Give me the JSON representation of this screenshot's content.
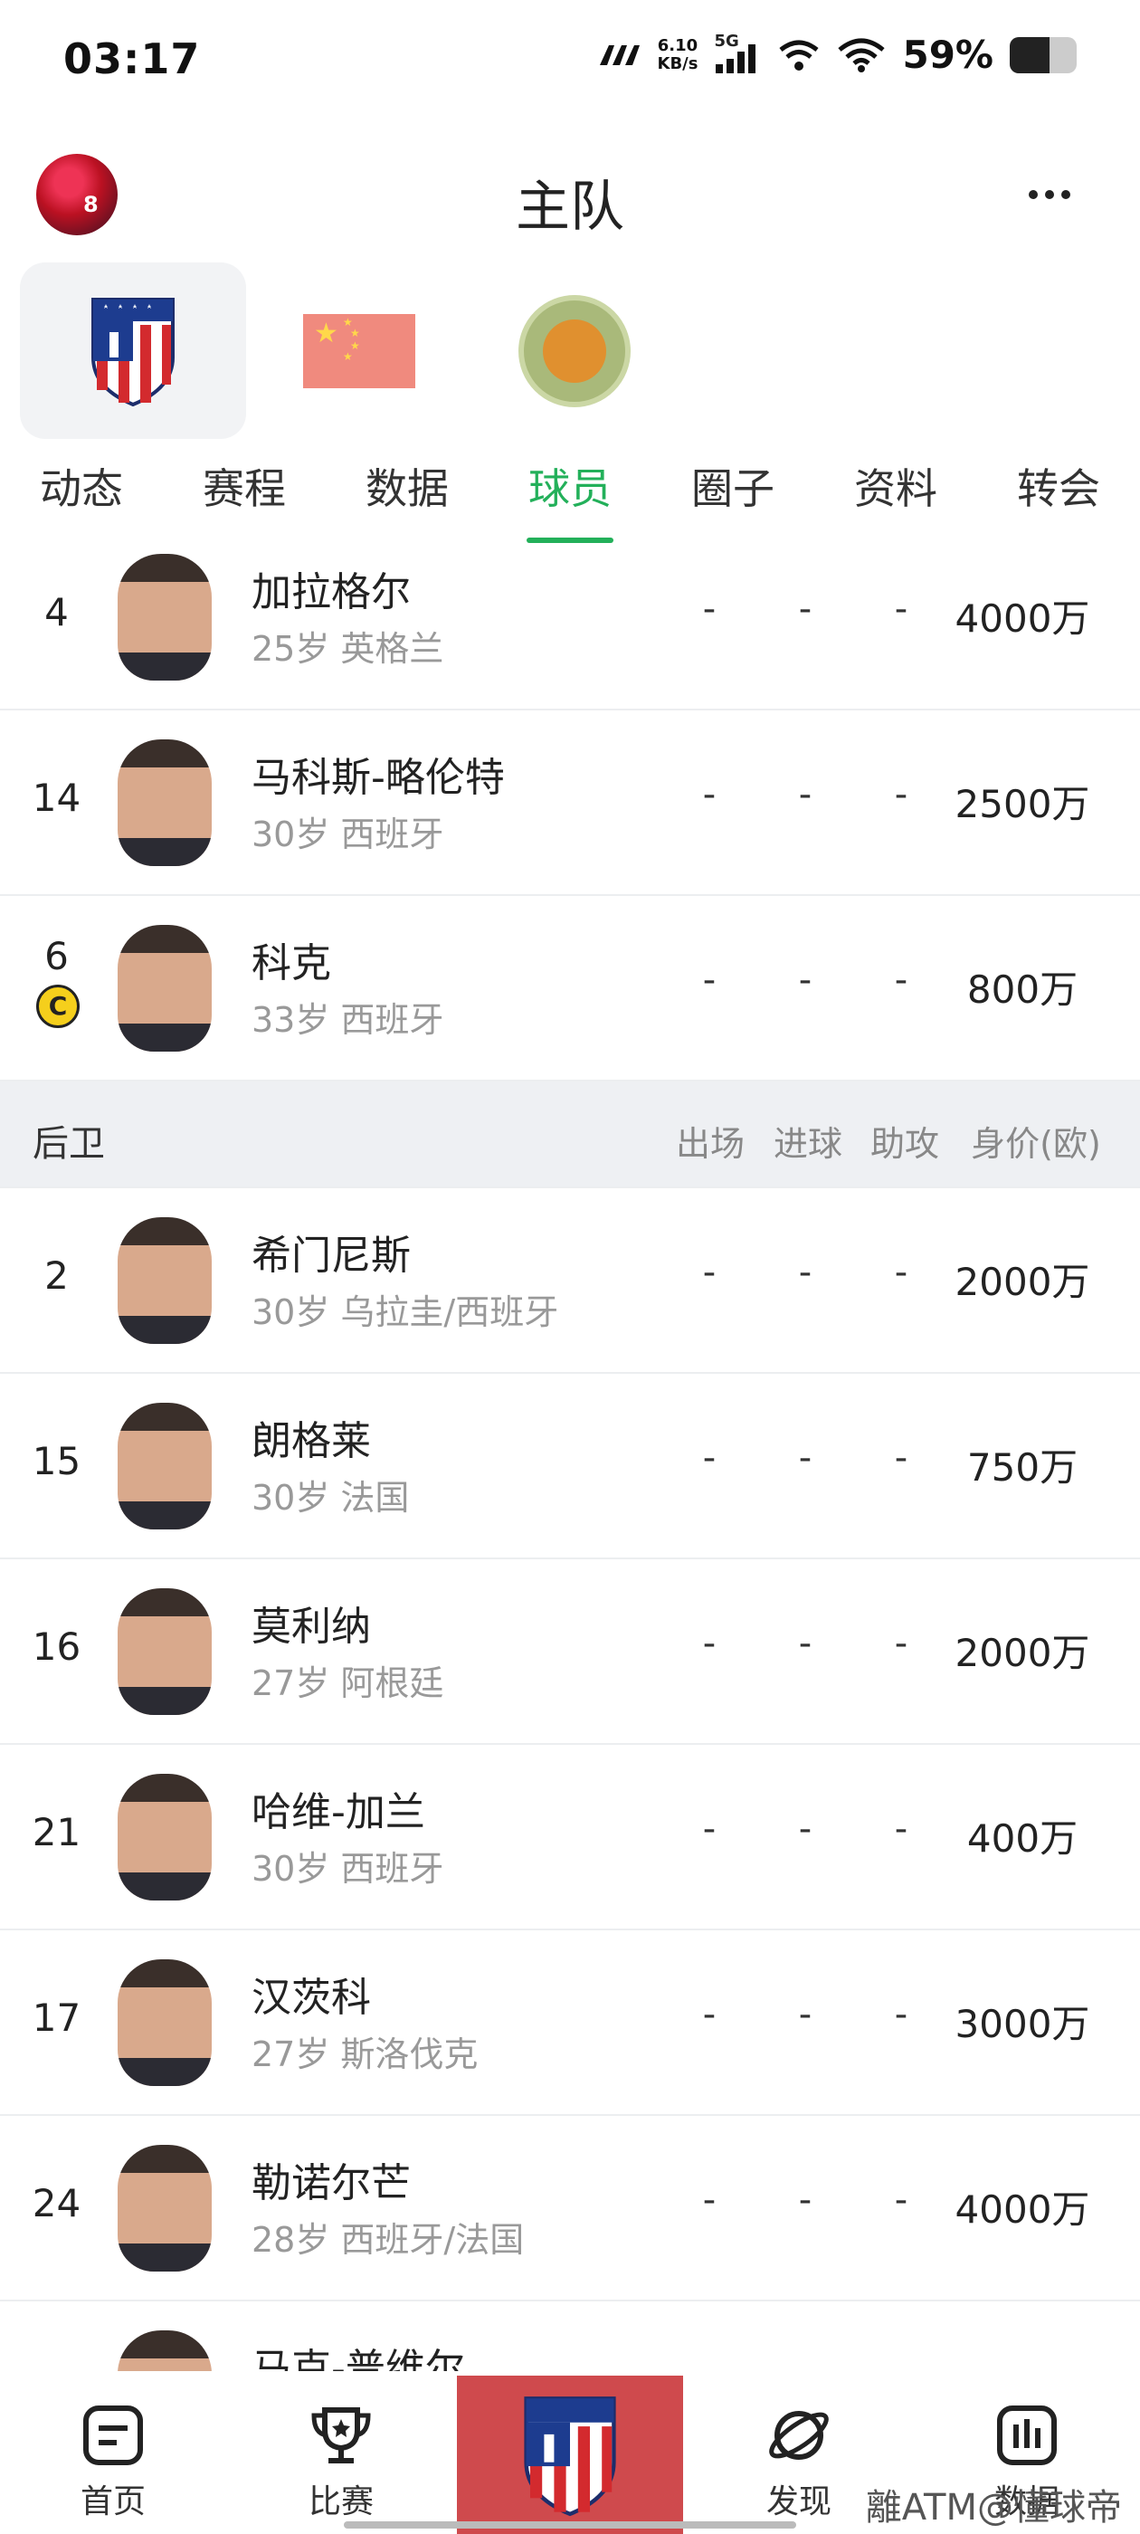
{
  "status_bar": {
    "time": "03:17",
    "net_speed_value": "6.10",
    "net_speed_unit": "KB/s",
    "signal_label": "5G",
    "battery_text": "59%",
    "battery_level": 0.59
  },
  "header": {
    "title": "主队",
    "avatar_number": "8"
  },
  "team_tabs": [
    {
      "name": "atletico-badge",
      "active": true
    },
    {
      "name": "china-flag",
      "active": false
    },
    {
      "name": "club-badge",
      "active": false
    }
  ],
  "nav_tabs": [
    "动态",
    "赛程",
    "数据",
    "球员",
    "圈子",
    "资料",
    "转会"
  ],
  "active_nav_tab": "球员",
  "section_defenders": {
    "title": "后卫",
    "columns": [
      "出场",
      "进球",
      "助攻",
      "身价(欧)"
    ]
  },
  "midfielders": [
    {
      "number": "4",
      "name": "加拉格尔",
      "info": "25岁 英格兰",
      "apps": "-",
      "goals": "-",
      "assists": "-",
      "value": "4000万"
    },
    {
      "number": "14",
      "name": "马科斯-略伦特",
      "info": "30岁 西班牙",
      "apps": "-",
      "goals": "-",
      "assists": "-",
      "value": "2500万"
    },
    {
      "number": "6",
      "name": "科克",
      "info": "33岁 西班牙",
      "apps": "-",
      "goals": "-",
      "assists": "-",
      "value": "800万",
      "captain": "C"
    }
  ],
  "defenders": [
    {
      "number": "2",
      "name": "希门尼斯",
      "info": "30岁 乌拉圭/西班牙",
      "apps": "-",
      "goals": "-",
      "assists": "-",
      "value": "2000万"
    },
    {
      "number": "15",
      "name": "朗格莱",
      "info": "30岁 法国",
      "apps": "-",
      "goals": "-",
      "assists": "-",
      "value": "750万"
    },
    {
      "number": "16",
      "name": "莫利纳",
      "info": "27岁 阿根廷",
      "apps": "-",
      "goals": "-",
      "assists": "-",
      "value": "2000万"
    },
    {
      "number": "21",
      "name": "哈维-加兰",
      "info": "30岁 西班牙",
      "apps": "-",
      "goals": "-",
      "assists": "-",
      "value": "400万"
    },
    {
      "number": "17",
      "name": "汉茨科",
      "info": "27岁 斯洛伐克",
      "apps": "-",
      "goals": "-",
      "assists": "-",
      "value": "3000万"
    },
    {
      "number": "24",
      "name": "勒诺尔芒",
      "info": "28岁 西班牙/法国",
      "apps": "-",
      "goals": "-",
      "assists": "-",
      "value": "4000万"
    },
    {
      "number": "",
      "name": "马克-普维尔",
      "info": "",
      "apps": "",
      "goals": "",
      "assists": "",
      "value": ""
    }
  ],
  "bottom_nav": {
    "home": "首页",
    "matches": "比赛",
    "discover": "发现",
    "data": "数据"
  },
  "watermark": "離ATM@懂球帝"
}
